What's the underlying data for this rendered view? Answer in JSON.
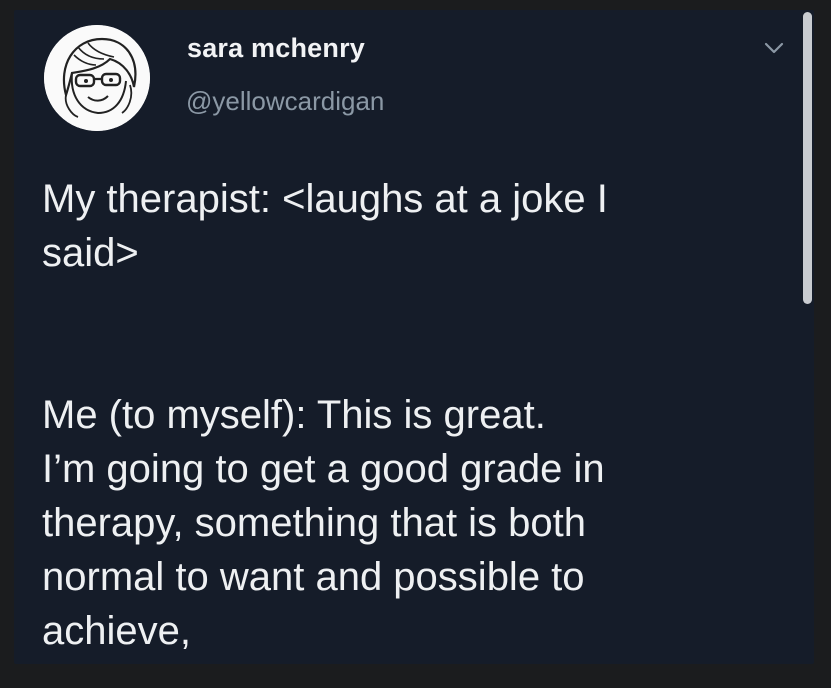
{
  "tweet": {
    "author": {
      "display_name": "sara mchenry",
      "handle": "@yellowcardigan",
      "avatar_icon": "cartoon-woman-with-glasses-avatar"
    },
    "menu_icon": "chevron-down-icon",
    "paragraphs": [
      "My therapist: <laughs at a joke I\nsaid>",
      "Me (to myself): This is great.\nI’m going to get a good grade in\ntherapy, something that is both\nnormal to want and possible to\nachieve,"
    ]
  },
  "colors": {
    "background": "#151c29",
    "text": "#eef0f2",
    "handle": "#8b98a5"
  }
}
